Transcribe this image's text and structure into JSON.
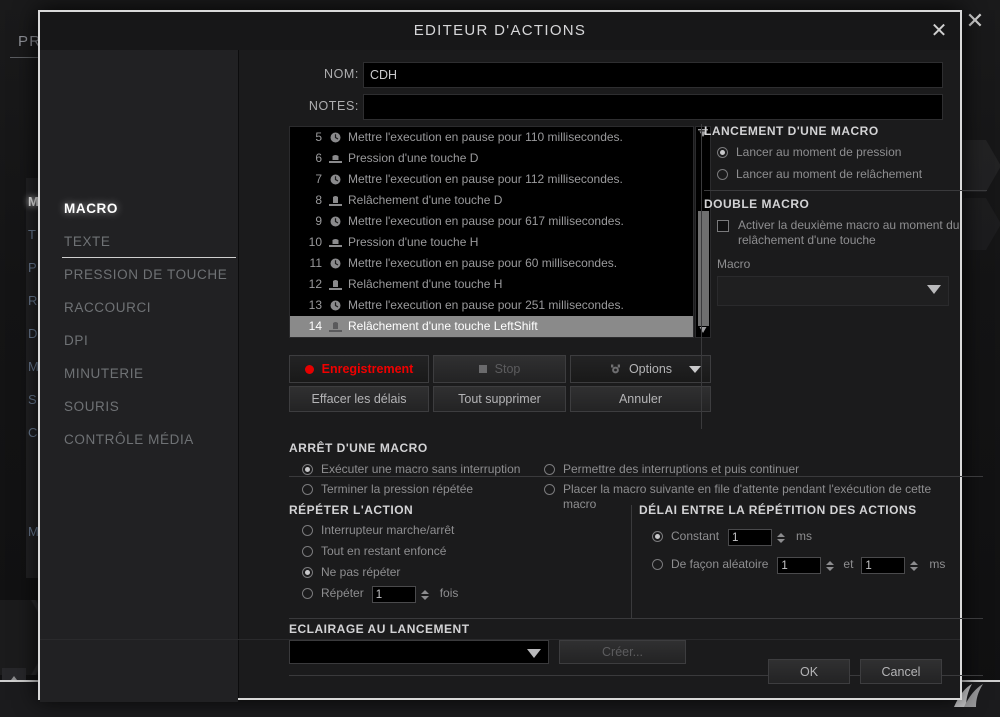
{
  "background": {
    "tab_label": "PR",
    "close_icon": "close-icon",
    "sidebar_partial": [
      "M",
      "T",
      "P",
      "R",
      "D",
      "M",
      "S",
      "C"
    ],
    "sidebar_extra": "M",
    "scroll_up_icon": "triangle-up-icon",
    "brand_logo": "corsair-sails-logo"
  },
  "dialog": {
    "title": "EDITEUR D'ACTIONS",
    "close_icon": "close-icon",
    "nav": {
      "items": [
        {
          "label": "MACRO",
          "active": true
        },
        {
          "label": "TEXTE",
          "active": false
        },
        {
          "label": "PRESSION DE TOUCHE",
          "active": false
        },
        {
          "label": "RACCOURCI",
          "active": false
        },
        {
          "label": "DPI",
          "active": false
        },
        {
          "label": "MINUTERIE",
          "active": false
        },
        {
          "label": "SOURIS",
          "active": false
        },
        {
          "label": "CONTRÔLE MÉDIA",
          "active": false
        }
      ]
    },
    "fields": {
      "name_label": "NOM:",
      "name_value": "CDH",
      "notes_label": "NOTES:",
      "notes_value": "",
      "notes_placeholder": ""
    },
    "action_list": {
      "rows": [
        {
          "index": "5",
          "icon": "clock-icon",
          "text": "Mettre l'execution en pause pour 110 millisecondes.",
          "selected": false
        },
        {
          "index": "6",
          "icon": "key-press-icon",
          "text": "Pression d'une touche D",
          "selected": false
        },
        {
          "index": "7",
          "icon": "clock-icon",
          "text": "Mettre l'execution en pause pour 112 millisecondes.",
          "selected": false
        },
        {
          "index": "8",
          "icon": "key-release-icon",
          "text": "Relâchement d'une touche D",
          "selected": false
        },
        {
          "index": "9",
          "icon": "clock-icon",
          "text": "Mettre l'execution en pause pour 617 millisecondes.",
          "selected": false
        },
        {
          "index": "10",
          "icon": "key-press-icon",
          "text": "Pression d'une touche H",
          "selected": false
        },
        {
          "index": "11",
          "icon": "clock-icon",
          "text": "Mettre l'execution en pause pour 60 millisecondes.",
          "selected": false
        },
        {
          "index": "12",
          "icon": "key-release-icon",
          "text": "Relâchement d'une touche H",
          "selected": false
        },
        {
          "index": "13",
          "icon": "clock-icon",
          "text": "Mettre l'execution en pause pour 251 millisecondes.",
          "selected": false
        },
        {
          "index": "14",
          "icon": "key-release-icon",
          "text": "Relâchement d'une touche LeftShift",
          "selected": true
        }
      ],
      "scroll_up_icon": "scroll-up-arrow-icon",
      "scroll_down_icon": "scroll-down-arrow-icon"
    },
    "macro_buttons": {
      "record": "Enregistrement",
      "stop": "Stop",
      "options": "Options",
      "clear_delays": "Effacer les délais",
      "delete_all": "Tout supprimer",
      "cancel": "Annuler",
      "record_dot_color": "#e60000",
      "record_text_color": "#f00000"
    },
    "launch": {
      "title": "LANCEMENT D'UNE MACRO",
      "options": [
        {
          "label": "Lancer au moment de pression",
          "selected": true
        },
        {
          "label": "Lancer au moment de relâchement",
          "selected": false
        }
      ]
    },
    "double_macro": {
      "title": "DOUBLE MACRO",
      "checkbox_label": "Activer la deuxième macro au moment du relâchement d'une touche",
      "checked": false,
      "macro_label": "Macro",
      "macro_value": ""
    },
    "stop_macro": {
      "title": "ARRÊT D'UNE MACRO",
      "options": [
        {
          "label": "Exécuter une macro sans interruption",
          "selected": true
        },
        {
          "label": "Permettre des interruptions et puis continuer",
          "selected": false
        },
        {
          "label": "Terminer la pression répétée",
          "selected": false
        },
        {
          "label": "Placer la macro suivante en file d'attente pendant l'exécution de cette macro",
          "selected": false
        }
      ]
    },
    "repeat_action": {
      "title": "RÉPÉTER L'ACTION",
      "options": [
        {
          "label": "Interrupteur marche/arrêt",
          "selected": false
        },
        {
          "label": "Tout en restant enfoncé",
          "selected": false
        },
        {
          "label": "Ne pas répéter",
          "selected": true
        },
        {
          "label": "Répéter",
          "selected": false
        }
      ],
      "repeat_count": "1",
      "times_suffix": "fois"
    },
    "repeat_delay": {
      "title": "DÉLAI ENTRE LA RÉPÉTITION DES ACTIONS",
      "constant_label": "Constant",
      "constant_selected": true,
      "constant_value": "1",
      "constant_unit": "ms",
      "random_label": "De façon aléatoire",
      "random_selected": false,
      "random_min": "1",
      "random_join": "et",
      "random_max": "1",
      "random_unit": "ms"
    },
    "lighting": {
      "title": "ECLAIRAGE AU LANCEMENT",
      "selected_value": "",
      "create_button": "Créer..."
    },
    "footer": {
      "ok": "OK",
      "cancel": "Cancel"
    }
  }
}
